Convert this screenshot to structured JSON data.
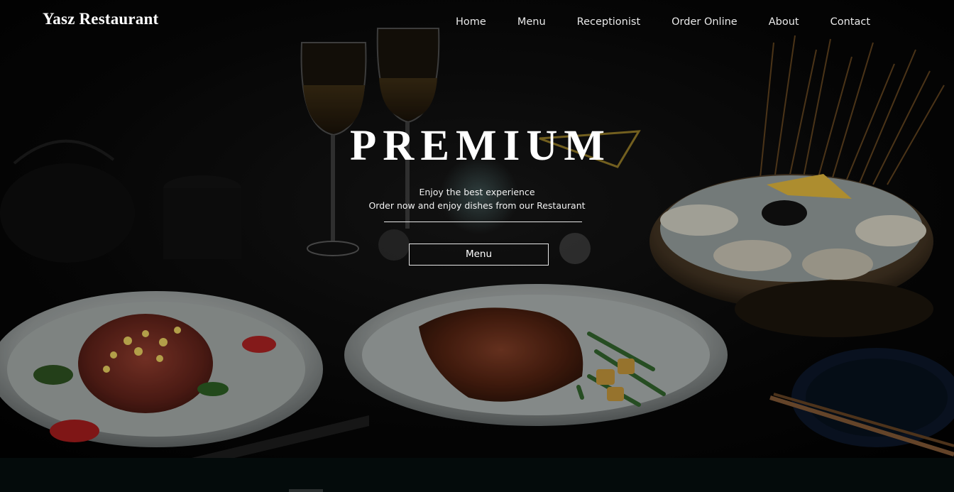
{
  "brand": {
    "name": "Yasz Restaurant"
  },
  "nav": {
    "items": [
      {
        "label": "Home"
      },
      {
        "label": "Menu"
      },
      {
        "label": "Receptionist"
      },
      {
        "label": "Order Online"
      },
      {
        "label": "About"
      },
      {
        "label": "Contact"
      }
    ]
  },
  "hero": {
    "title": "PREMIUM",
    "line1": "Enjoy the best experience",
    "line2": "Order now and enjoy dishes from our Restaurant",
    "button_label": "Menu",
    "image": "dark food photograph with grilled steak plates, ribs, oysters, wine glasses"
  },
  "colors": {
    "hero_overlay": "#000000",
    "text": "#ffffff",
    "band": "#040b0b"
  }
}
